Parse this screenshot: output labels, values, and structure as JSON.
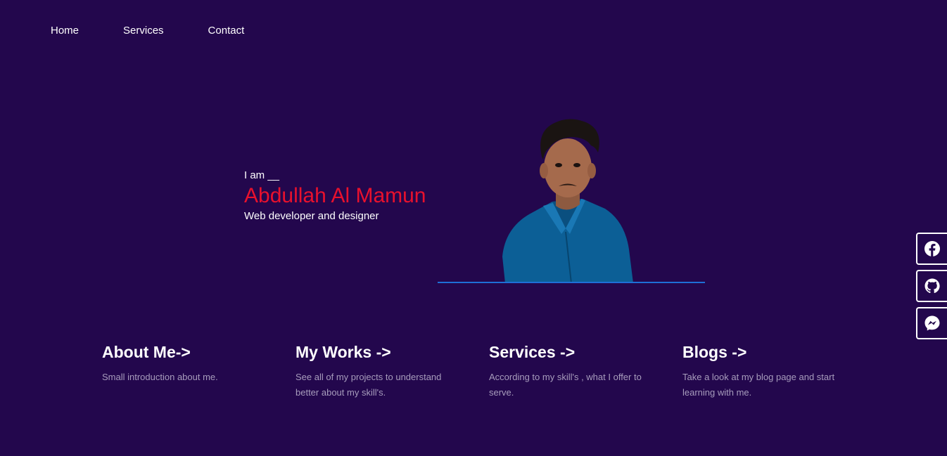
{
  "nav": {
    "items": [
      {
        "label": "Home"
      },
      {
        "label": "Services"
      },
      {
        "label": "Contact"
      }
    ]
  },
  "hero": {
    "intro": "I am __",
    "name": "Abdullah Al Mamun",
    "role": "Web developer and designer"
  },
  "colors": {
    "background": "#23074d",
    "name_accent": "#e8112d",
    "divider": "#1e6fd6",
    "muted_text": "#a79cbc"
  },
  "social": {
    "icons": [
      "facebook-icon",
      "github-icon",
      "messenger-icon"
    ]
  },
  "cards": [
    {
      "title": "About Me->",
      "description": "Small introduction about me."
    },
    {
      "title": "My Works ->",
      "description": "See all of my projects to understand better about my skill's."
    },
    {
      "title": "Services ->",
      "description": "According to my skill's , what I offer to serve."
    },
    {
      "title": "Blogs ->",
      "description": "Take a look at my blog page and start learning with me."
    }
  ]
}
